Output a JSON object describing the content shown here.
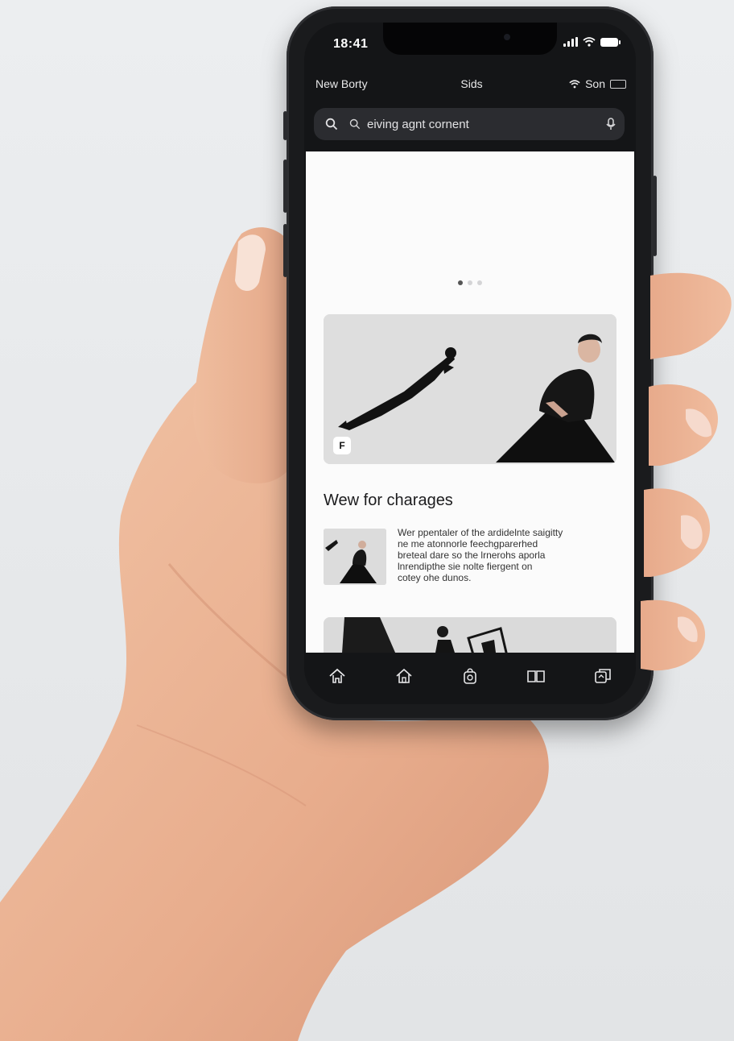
{
  "status_bar": {
    "time": "18:41"
  },
  "nav": {
    "left_label": "New Borty",
    "center_label": "Sids",
    "right_label": "Son"
  },
  "search": {
    "value": "eiving agnt cornent"
  },
  "carousel": {
    "dot_count": 3,
    "active_index": 0
  },
  "hero": {
    "badge_text": "F"
  },
  "section": {
    "title": "Wew for charages"
  },
  "article": {
    "lines": [
      "Wer ppentaler of the ardidelnte saigitty",
      "ne me atonnorle feechgparerhed",
      "breteal dare so the lrnerohs aporla",
      "lnrendipthe sie nolte fiergent on",
      "cotey ohe dunos."
    ]
  },
  "tab_bar": {
    "tabs": [
      "home-outline-icon",
      "home-icon",
      "bag-icon",
      "book-icon",
      "tabs-icon"
    ]
  },
  "colors": {
    "phone_body": "#1a1b1d",
    "screen_dark": "#141517",
    "content_bg": "#fbfbfb",
    "background": "#e6e8ea"
  }
}
